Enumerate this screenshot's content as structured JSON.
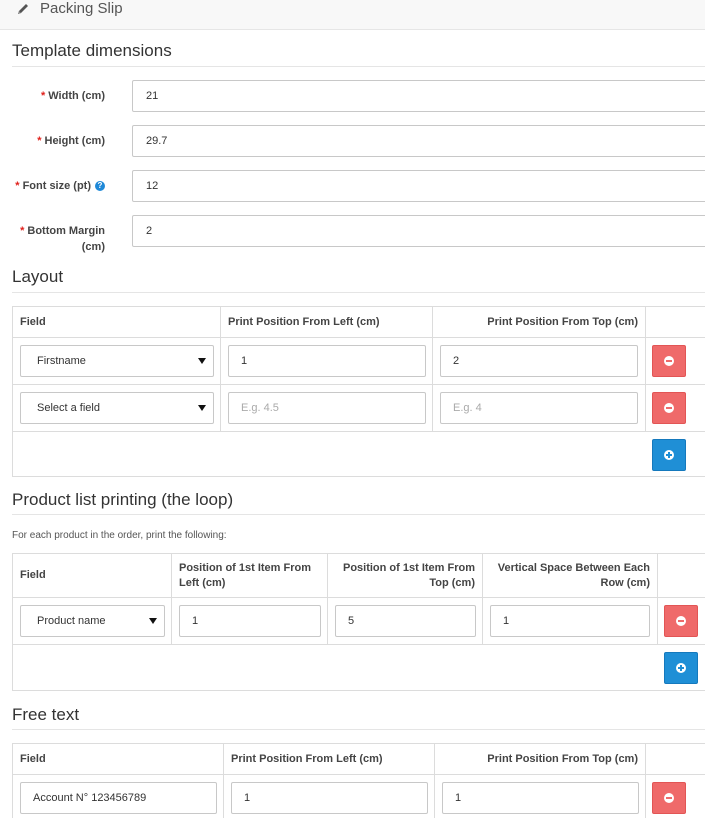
{
  "header": {
    "title": "Packing Slip"
  },
  "template_dimensions": {
    "title": "Template dimensions",
    "fields": [
      {
        "label": "Width (cm)",
        "value": "21"
      },
      {
        "label": "Height (cm)",
        "value": "29.7"
      },
      {
        "label": "Font size (pt)",
        "value": "12",
        "help": "?"
      },
      {
        "label_line1": "Bottom Margin",
        "label_line2": "(cm)",
        "value": "2"
      }
    ]
  },
  "layout": {
    "title": "Layout",
    "columns": [
      "Field",
      "Print Position From Left (cm)",
      "Print Position From Top (cm)"
    ],
    "rows": [
      {
        "field": "Firstname",
        "left": "1",
        "top": "2"
      },
      {
        "field": "Select a field",
        "left_placeholder": "E.g. 4.5",
        "top_placeholder": "E.g. 4"
      }
    ]
  },
  "product_loop": {
    "title": "Product list printing (the loop)",
    "description": "For each product in the order, print the following:",
    "columns": [
      "Field",
      "Position of 1st Item From Left (cm)",
      "Position of 1st Item From Top (cm)",
      "Vertical Space Between Each Row (cm)"
    ],
    "rows": [
      {
        "field": "Product name",
        "left": "1",
        "top": "5",
        "spacing": "1"
      }
    ]
  },
  "free_text": {
    "title": "Free text",
    "columns": [
      "Field",
      "Print Position From Left (cm)",
      "Print Position From Top (cm)"
    ],
    "rows": [
      {
        "field": "Account N° 123456789",
        "left": "1",
        "top": "1"
      }
    ]
  },
  "colors": {
    "required": "#e0201b",
    "delete": "#ef6a6a",
    "add": "#1f8fd6",
    "help": "#1f89d8"
  },
  "icons": {
    "header": "pencil-icon",
    "delete": "minus-circle-icon",
    "add": "plus-circle-icon",
    "help": "question-circle-icon",
    "dropdown": "caret-down-icon"
  }
}
